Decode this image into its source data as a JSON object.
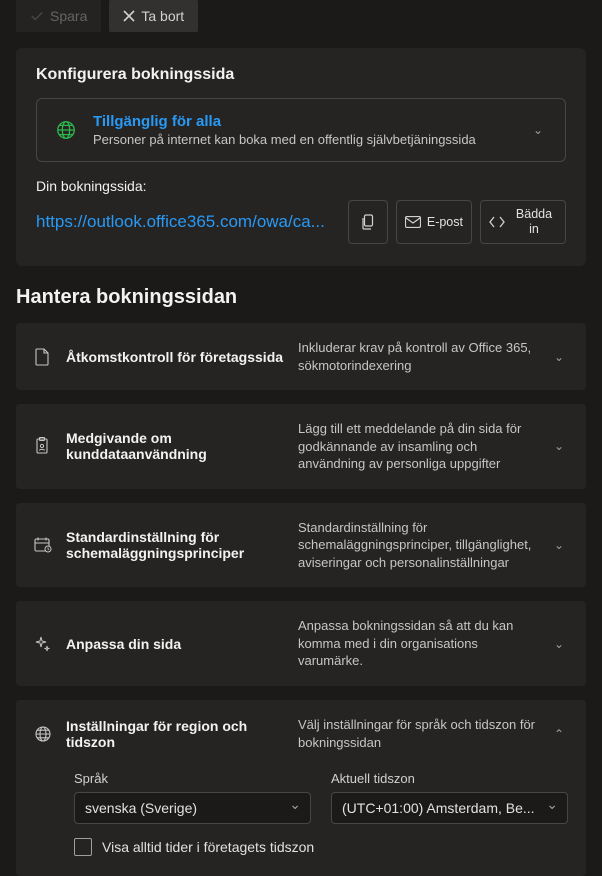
{
  "topbar": {
    "save_label": "Spara",
    "remove_label": "Ta bort"
  },
  "config": {
    "title": "Konfigurera bokningssida",
    "availability": {
      "title": "Tillgänglig för alla",
      "subtitle": "Personer på internet kan boka med en offentlig självbetjäningssida"
    },
    "url_label": "Din bokningssida:",
    "url": "https://outlook.office365.com/owa/ca...",
    "copy_label": "",
    "email_label": "E-post",
    "embed_label": "Bädda in"
  },
  "section_title": "Hantera bokningssidan",
  "accordions": [
    {
      "title": "Åtkomstkontroll för företagssida",
      "desc": "Inkluderar krav på kontroll av Office 365, sökmotorindexering"
    },
    {
      "title": "Medgivande om kunddataanvändning",
      "desc": "Lägg till ett meddelande på din sida för godkännande av insamling och användning av personliga uppgifter"
    },
    {
      "title": "Standardinställning för schemaläggningsprinciper",
      "desc": "Standardinställning för schemaläggningsprinciper, tillgänglighet, aviseringar och personalinställningar"
    },
    {
      "title": "Anpassa din sida",
      "desc": "Anpassa bokningssidan så att du kan komma med i din organisations varumärke."
    },
    {
      "title": "Inställningar för region och tidszon",
      "desc": "Välj inställningar för språk och tidszon för bokningssidan"
    }
  ],
  "region": {
    "language_label": "Språk",
    "language_value": "svenska (Sverige)",
    "timezone_label": "Aktuell tidszon",
    "timezone_value": "(UTC+01:00) Amsterdam, Be...",
    "checkbox_label": "Visa alltid tider i företagets tidszon"
  }
}
